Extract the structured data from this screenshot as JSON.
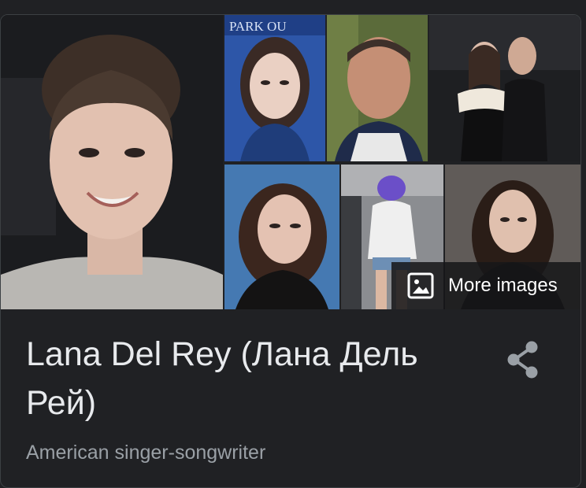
{
  "knowledge_panel": {
    "title": "Lana Del Rey (Лана Дель Рей)",
    "subtitle": "American singer-songwriter",
    "more_images_label": "More images",
    "photo_backdrop_text": "PARK  OU",
    "icons": {
      "more_images": "image-icon",
      "share": "share-icon"
    },
    "colors": {
      "background": "#202124",
      "title_text": "#e8eaed",
      "subtitle_text": "#9aa0a6",
      "share_icon": "#9aa0a6",
      "overlay_text": "#ffffff"
    }
  }
}
